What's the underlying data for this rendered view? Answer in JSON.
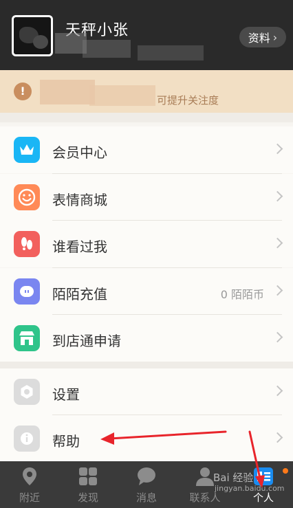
{
  "header": {
    "username": "天秤小张",
    "profile_button_label": "资料"
  },
  "notice": {
    "text": "可提升关注度"
  },
  "menu": {
    "group1": [
      {
        "label": "会员中心",
        "value": "",
        "icon": "crown-icon",
        "color": "#1ab6f5"
      },
      {
        "label": "表情商城",
        "value": "",
        "icon": "smiley-icon",
        "color": "#ff8a57"
      },
      {
        "label": "谁看过我",
        "value": "",
        "icon": "footprints-icon",
        "color": "#f2605d"
      },
      {
        "label": "陌陌充值",
        "value": "0 陌陌币",
        "icon": "coin-icon",
        "color": "#7a86f0"
      },
      {
        "label": "到店通申请",
        "value": "",
        "icon": "store-icon",
        "color": "#2fc48a"
      }
    ],
    "group2": [
      {
        "label": "设置",
        "value": "",
        "icon": "gear-icon",
        "color": "#dcdcdc"
      },
      {
        "label": "帮助",
        "value": "",
        "icon": "info-icon",
        "color": "#dcdcdc"
      }
    ]
  },
  "tabbar": {
    "tabs": [
      {
        "label": "附近",
        "icon": "location-pin-icon"
      },
      {
        "label": "发现",
        "icon": "grid-icon"
      },
      {
        "label": "消息",
        "icon": "chat-bubble-icon"
      },
      {
        "label": "联系人",
        "icon": "contact-icon"
      },
      {
        "label": "个人",
        "icon": "profile-card-icon"
      }
    ],
    "active_tab": "个人"
  },
  "watermark": {
    "brand": "Bai 经验",
    "url": "jingyan.baidu.com"
  },
  "colors": {
    "header_bg": "#2a2a2a",
    "notice_bg": "#f2dfc4",
    "tabbar_bg": "#3a3a3a",
    "accent_orange": "#ff7a1a",
    "annotation_red": "#e8242b"
  }
}
